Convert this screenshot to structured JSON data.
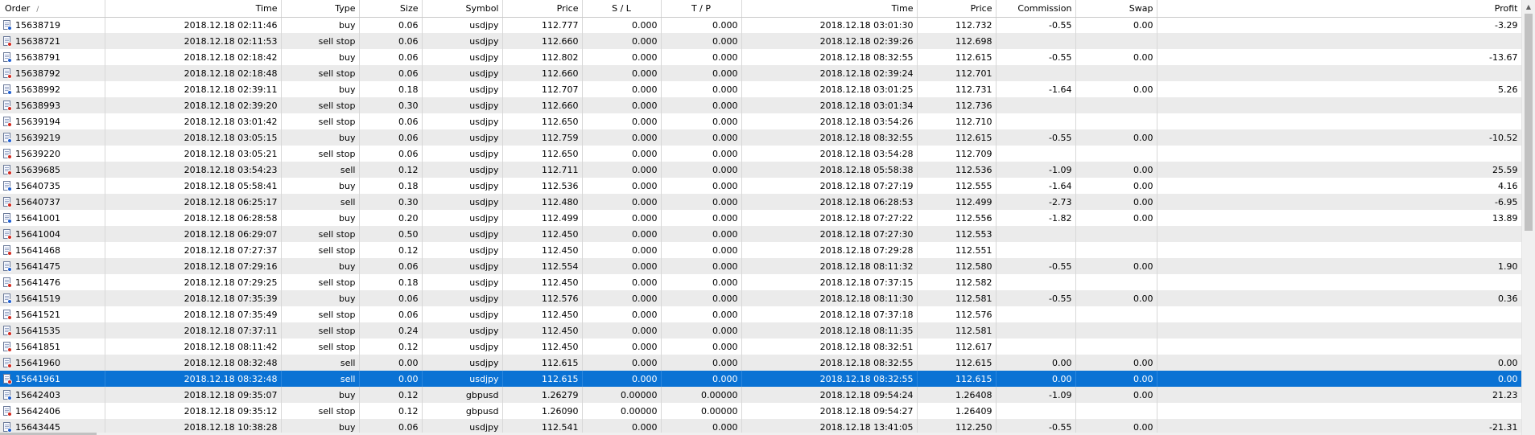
{
  "columns": {
    "order": "Order",
    "order_sort": "/",
    "time": "Time",
    "type": "Type",
    "size": "Size",
    "symbol": "Symbol",
    "price": "Price",
    "sl": "S / L",
    "tp": "T / P",
    "close_time": "Time",
    "close_price": "Price",
    "commission": "Commission",
    "swap": "Swap",
    "profit": "Profit"
  },
  "rows": [
    {
      "order": "15638719",
      "time": "2018.12.18 02:11:46",
      "type": "buy",
      "size": "0.06",
      "symbol": "usdjpy",
      "price": "112.777",
      "sl": "0.000",
      "tp": "0.000",
      "close_time": "2018.12.18 03:01:30",
      "close_price": "112.732",
      "commission": "-0.55",
      "swap": "0.00",
      "profit": "-3.29",
      "icon": "buy-order-icon"
    },
    {
      "order": "15638721",
      "time": "2018.12.18 02:11:53",
      "type": "sell stop",
      "size": "0.06",
      "symbol": "usdjpy",
      "price": "112.660",
      "sl": "0.000",
      "tp": "0.000",
      "close_time": "2018.12.18 02:39:26",
      "close_price": "112.698",
      "commission": "",
      "swap": "",
      "profit": "",
      "icon": "sell-order-icon"
    },
    {
      "order": "15638791",
      "time": "2018.12.18 02:18:42",
      "type": "buy",
      "size": "0.06",
      "symbol": "usdjpy",
      "price": "112.802",
      "sl": "0.000",
      "tp": "0.000",
      "close_time": "2018.12.18 08:32:55",
      "close_price": "112.615",
      "commission": "-0.55",
      "swap": "0.00",
      "profit": "-13.67",
      "icon": "buy-order-icon"
    },
    {
      "order": "15638792",
      "time": "2018.12.18 02:18:48",
      "type": "sell stop",
      "size": "0.06",
      "symbol": "usdjpy",
      "price": "112.660",
      "sl": "0.000",
      "tp": "0.000",
      "close_time": "2018.12.18 02:39:24",
      "close_price": "112.701",
      "commission": "",
      "swap": "",
      "profit": "",
      "icon": "sell-order-icon"
    },
    {
      "order": "15638992",
      "time": "2018.12.18 02:39:11",
      "type": "buy",
      "size": "0.18",
      "symbol": "usdjpy",
      "price": "112.707",
      "sl": "0.000",
      "tp": "0.000",
      "close_time": "2018.12.18 03:01:25",
      "close_price": "112.731",
      "commission": "-1.64",
      "swap": "0.00",
      "profit": "5.26",
      "icon": "buy-order-icon"
    },
    {
      "order": "15638993",
      "time": "2018.12.18 02:39:20",
      "type": "sell stop",
      "size": "0.30",
      "symbol": "usdjpy",
      "price": "112.660",
      "sl": "0.000",
      "tp": "0.000",
      "close_time": "2018.12.18 03:01:34",
      "close_price": "112.736",
      "commission": "",
      "swap": "",
      "profit": "",
      "icon": "sell-order-icon"
    },
    {
      "order": "15639194",
      "time": "2018.12.18 03:01:42",
      "type": "sell stop",
      "size": "0.06",
      "symbol": "usdjpy",
      "price": "112.650",
      "sl": "0.000",
      "tp": "0.000",
      "close_time": "2018.12.18 03:54:26",
      "close_price": "112.710",
      "commission": "",
      "swap": "",
      "profit": "",
      "icon": "sell-order-icon"
    },
    {
      "order": "15639219",
      "time": "2018.12.18 03:05:15",
      "type": "buy",
      "size": "0.06",
      "symbol": "usdjpy",
      "price": "112.759",
      "sl": "0.000",
      "tp": "0.000",
      "close_time": "2018.12.18 08:32:55",
      "close_price": "112.615",
      "commission": "-0.55",
      "swap": "0.00",
      "profit": "-10.52",
      "icon": "buy-order-icon"
    },
    {
      "order": "15639220",
      "time": "2018.12.18 03:05:21",
      "type": "sell stop",
      "size": "0.06",
      "symbol": "usdjpy",
      "price": "112.650",
      "sl": "0.000",
      "tp": "0.000",
      "close_time": "2018.12.18 03:54:28",
      "close_price": "112.709",
      "commission": "",
      "swap": "",
      "profit": "",
      "icon": "sell-order-icon"
    },
    {
      "order": "15639685",
      "time": "2018.12.18 03:54:23",
      "type": "sell",
      "size": "0.12",
      "symbol": "usdjpy",
      "price": "112.711",
      "sl": "0.000",
      "tp": "0.000",
      "close_time": "2018.12.18 05:58:38",
      "close_price": "112.536",
      "commission": "-1.09",
      "swap": "0.00",
      "profit": "25.59",
      "icon": "sell-order-icon"
    },
    {
      "order": "15640735",
      "time": "2018.12.18 05:58:41",
      "type": "buy",
      "size": "0.18",
      "symbol": "usdjpy",
      "price": "112.536",
      "sl": "0.000",
      "tp": "0.000",
      "close_time": "2018.12.18 07:27:19",
      "close_price": "112.555",
      "commission": "-1.64",
      "swap": "0.00",
      "profit": "4.16",
      "icon": "buy-order-icon"
    },
    {
      "order": "15640737",
      "time": "2018.12.18 06:25:17",
      "type": "sell",
      "size": "0.30",
      "symbol": "usdjpy",
      "price": "112.480",
      "sl": "0.000",
      "tp": "0.000",
      "close_time": "2018.12.18 06:28:53",
      "close_price": "112.499",
      "commission": "-2.73",
      "swap": "0.00",
      "profit": "-6.95",
      "icon": "sell-order-icon"
    },
    {
      "order": "15641001",
      "time": "2018.12.18 06:28:58",
      "type": "buy",
      "size": "0.20",
      "symbol": "usdjpy",
      "price": "112.499",
      "sl": "0.000",
      "tp": "0.000",
      "close_time": "2018.12.18 07:27:22",
      "close_price": "112.556",
      "commission": "-1.82",
      "swap": "0.00",
      "profit": "13.89",
      "icon": "buy-order-icon"
    },
    {
      "order": "15641004",
      "time": "2018.12.18 06:29:07",
      "type": "sell stop",
      "size": "0.50",
      "symbol": "usdjpy",
      "price": "112.450",
      "sl": "0.000",
      "tp": "0.000",
      "close_time": "2018.12.18 07:27:30",
      "close_price": "112.553",
      "commission": "",
      "swap": "",
      "profit": "",
      "icon": "sell-order-icon"
    },
    {
      "order": "15641468",
      "time": "2018.12.18 07:27:37",
      "type": "sell stop",
      "size": "0.12",
      "symbol": "usdjpy",
      "price": "112.450",
      "sl": "0.000",
      "tp": "0.000",
      "close_time": "2018.12.18 07:29:28",
      "close_price": "112.551",
      "commission": "",
      "swap": "",
      "profit": "",
      "icon": "sell-order-icon"
    },
    {
      "order": "15641475",
      "time": "2018.12.18 07:29:16",
      "type": "buy",
      "size": "0.06",
      "symbol": "usdjpy",
      "price": "112.554",
      "sl": "0.000",
      "tp": "0.000",
      "close_time": "2018.12.18 08:11:32",
      "close_price": "112.580",
      "commission": "-0.55",
      "swap": "0.00",
      "profit": "1.90",
      "icon": "buy-order-icon"
    },
    {
      "order": "15641476",
      "time": "2018.12.18 07:29:25",
      "type": "sell stop",
      "size": "0.18",
      "symbol": "usdjpy",
      "price": "112.450",
      "sl": "0.000",
      "tp": "0.000",
      "close_time": "2018.12.18 07:37:15",
      "close_price": "112.582",
      "commission": "",
      "swap": "",
      "profit": "",
      "icon": "sell-order-icon"
    },
    {
      "order": "15641519",
      "time": "2018.12.18 07:35:39",
      "type": "buy",
      "size": "0.06",
      "symbol": "usdjpy",
      "price": "112.576",
      "sl": "0.000",
      "tp": "0.000",
      "close_time": "2018.12.18 08:11:30",
      "close_price": "112.581",
      "commission": "-0.55",
      "swap": "0.00",
      "profit": "0.36",
      "icon": "buy-order-icon"
    },
    {
      "order": "15641521",
      "time": "2018.12.18 07:35:49",
      "type": "sell stop",
      "size": "0.06",
      "symbol": "usdjpy",
      "price": "112.450",
      "sl": "0.000",
      "tp": "0.000",
      "close_time": "2018.12.18 07:37:18",
      "close_price": "112.576",
      "commission": "",
      "swap": "",
      "profit": "",
      "icon": "sell-order-icon"
    },
    {
      "order": "15641535",
      "time": "2018.12.18 07:37:11",
      "type": "sell stop",
      "size": "0.24",
      "symbol": "usdjpy",
      "price": "112.450",
      "sl": "0.000",
      "tp": "0.000",
      "close_time": "2018.12.18 08:11:35",
      "close_price": "112.581",
      "commission": "",
      "swap": "",
      "profit": "",
      "icon": "sell-order-icon"
    },
    {
      "order": "15641851",
      "time": "2018.12.18 08:11:42",
      "type": "sell stop",
      "size": "0.12",
      "symbol": "usdjpy",
      "price": "112.450",
      "sl": "0.000",
      "tp": "0.000",
      "close_time": "2018.12.18 08:32:51",
      "close_price": "112.617",
      "commission": "",
      "swap": "",
      "profit": "",
      "icon": "sell-order-icon"
    },
    {
      "order": "15641960",
      "time": "2018.12.18 08:32:48",
      "type": "sell",
      "size": "0.00",
      "symbol": "usdjpy",
      "price": "112.615",
      "sl": "0.000",
      "tp": "0.000",
      "close_time": "2018.12.18 08:32:55",
      "close_price": "112.615",
      "commission": "0.00",
      "swap": "0.00",
      "profit": "0.00",
      "icon": "sell-order-icon"
    },
    {
      "order": "15641961",
      "time": "2018.12.18 08:32:48",
      "type": "sell",
      "size": "0.00",
      "symbol": "usdjpy",
      "price": "112.615",
      "sl": "0.000",
      "tp": "0.000",
      "close_time": "2018.12.18 08:32:55",
      "close_price": "112.615",
      "commission": "0.00",
      "swap": "0.00",
      "profit": "0.00",
      "icon": "sell-order-icon",
      "selected": true
    },
    {
      "order": "15642403",
      "time": "2018.12.18 09:35:07",
      "type": "buy",
      "size": "0.12",
      "symbol": "gbpusd",
      "price": "1.26279",
      "sl": "0.00000",
      "tp": "0.00000",
      "close_time": "2018.12.18 09:54:24",
      "close_price": "1.26408",
      "commission": "-1.09",
      "swap": "0.00",
      "profit": "21.23",
      "icon": "buy-order-icon"
    },
    {
      "order": "15642406",
      "time": "2018.12.18 09:35:12",
      "type": "sell stop",
      "size": "0.12",
      "symbol": "gbpusd",
      "price": "1.26090",
      "sl": "0.00000",
      "tp": "0.00000",
      "close_time": "2018.12.18 09:54:27",
      "close_price": "1.26409",
      "commission": "",
      "swap": "",
      "profit": "",
      "icon": "sell-order-icon"
    },
    {
      "order": "15643445",
      "time": "2018.12.18 10:38:28",
      "type": "buy",
      "size": "0.06",
      "symbol": "usdjpy",
      "price": "112.541",
      "sl": "0.000",
      "tp": "0.000",
      "close_time": "2018.12.18 13:41:05",
      "close_price": "112.250",
      "commission": "-0.55",
      "swap": "0.00",
      "profit": "-21.31",
      "icon": "buy-order-icon"
    }
  ],
  "colors": {
    "selected_row": "#0a72d4",
    "alt_row": "#ebebeb",
    "buy_dot": "#1f5fd1",
    "sell_dot": "#d32a1f"
  },
  "scrollbar": {
    "up_arrow": "▲"
  }
}
